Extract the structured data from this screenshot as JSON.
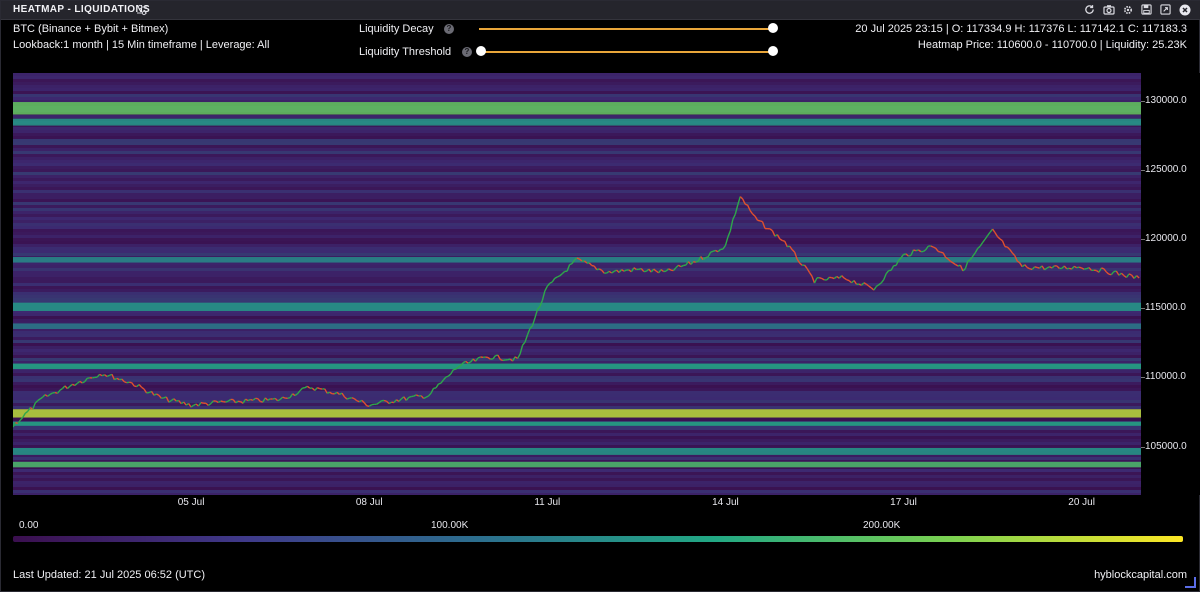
{
  "window": {
    "title": "HEATMAP - LIQUIDATIONS",
    "toolbar_icons": [
      "refresh-icon",
      "camera-icon",
      "settings-icon",
      "save-icon",
      "expand-icon",
      "close-icon"
    ]
  },
  "info": {
    "symbol": "BTC (Binance + Bybit + Bitmex)",
    "lookback": "Lookback:1 month | 15 Min timeframe | Leverage: All",
    "ohlc": "20 Jul 2025 23:15 | O: 117334.9 H: 117376 L: 117142.1 C: 117183.3",
    "heatmap_info": "Heatmap Price: 110600.0 - 110700.0 | Liquidity: 25.23K"
  },
  "controls": {
    "decay_label": "Liquidity Decay",
    "decay_value": 1.0,
    "threshold_label": "Liquidity Threshold",
    "threshold_low": 0.0,
    "threshold_high": 1.0,
    "help_glyph": "?"
  },
  "colors": {
    "slider": "#e9a63a",
    "candle_up": "#2ea84a",
    "candle_down": "#e0502e",
    "scale": [
      "#3b0f4f",
      "#3f3a8a",
      "#2c6f8e",
      "#22a884",
      "#7ad151",
      "#fde725"
    ]
  },
  "chart_data": {
    "type": "heatmap",
    "x_ticks": [
      "05 Jul",
      "08 Jul",
      "11 Jul",
      "14 Jul",
      "17 Jul",
      "20 Jul"
    ],
    "y_ticks": [
      "130000.0",
      "125000.0",
      "120000.0",
      "115000.0",
      "110000.0",
      "105000.0"
    ],
    "y_tick_values": [
      130000,
      125000,
      120000,
      115000,
      110000,
      105000
    ],
    "ylim": [
      101500,
      132000
    ],
    "x_range": [
      "2025-07-02",
      "2025-07-21"
    ],
    "price_path": [
      [
        "2025-07-02",
        106500
      ],
      [
        "2025-07-02 12:00",
        108500
      ],
      [
        "2025-07-03",
        109500
      ],
      [
        "2025-07-03 12:00",
        110300
      ],
      [
        "2025-07-04",
        109600
      ],
      [
        "2025-07-04 12:00",
        108500
      ],
      [
        "2025-07-05",
        108000
      ],
      [
        "2025-07-05 12:00",
        108200
      ],
      [
        "2025-07-06",
        108300
      ],
      [
        "2025-07-06 12:00",
        108400
      ],
      [
        "2025-07-07",
        109300
      ],
      [
        "2025-07-07 12:00",
        108800
      ],
      [
        "2025-07-08",
        108000
      ],
      [
        "2025-07-08 12:00",
        108400
      ],
      [
        "2025-07-09",
        108700
      ],
      [
        "2025-07-09 12:00",
        110800
      ],
      [
        "2025-07-10",
        111500
      ],
      [
        "2025-07-10 12:00",
        111300
      ],
      [
        "2025-07-11",
        116500
      ],
      [
        "2025-07-11 12:00",
        118500
      ],
      [
        "2025-07-12",
        117600
      ],
      [
        "2025-07-12 12:00",
        117800
      ],
      [
        "2025-07-13",
        117600
      ],
      [
        "2025-07-13 12:00",
        118400
      ],
      [
        "2025-07-14",
        119500
      ],
      [
        "2025-07-14 06:00",
        123100
      ],
      [
        "2025-07-14 12:00",
        121500
      ],
      [
        "2025-07-15",
        119800
      ],
      [
        "2025-07-15 12:00",
        117000
      ],
      [
        "2025-07-16",
        117200
      ],
      [
        "2025-07-16 12:00",
        116400
      ],
      [
        "2025-07-17",
        118800
      ],
      [
        "2025-07-17 12:00",
        119500
      ],
      [
        "2025-07-18",
        117800
      ],
      [
        "2025-07-18 12:00",
        120600
      ],
      [
        "2025-07-19",
        118000
      ],
      [
        "2025-07-19 12:00",
        117900
      ],
      [
        "2025-07-20",
        118000
      ],
      [
        "2025-07-20 12:00",
        117600
      ],
      [
        "2025-07-20 23:15",
        117183
      ]
    ],
    "liquidity_bands": [
      {
        "low": 129000,
        "high": 129900,
        "intensity": 0.75
      },
      {
        "low": 128200,
        "high": 128700,
        "intensity": 0.55
      },
      {
        "low": 118300,
        "high": 118700,
        "intensity": 0.5
      },
      {
        "low": 114800,
        "high": 115400,
        "intensity": 0.55
      },
      {
        "low": 113500,
        "high": 113900,
        "intensity": 0.45
      },
      {
        "low": 110600,
        "high": 111000,
        "intensity": 0.6
      },
      {
        "low": 107100,
        "high": 107700,
        "intensity": 0.9
      },
      {
        "low": 106500,
        "high": 106800,
        "intensity": 0.6
      },
      {
        "low": 104400,
        "high": 104900,
        "intensity": 0.55
      },
      {
        "low": 103500,
        "high": 103900,
        "intensity": 0.7
      }
    ],
    "color_scale_ticks": [
      "0.00",
      "100.00K",
      "200.00K"
    ]
  },
  "footer": {
    "last_updated": "Last Updated: 21 Jul 2025 06:52 (UTC)",
    "site": "hyblockcapital.com"
  }
}
